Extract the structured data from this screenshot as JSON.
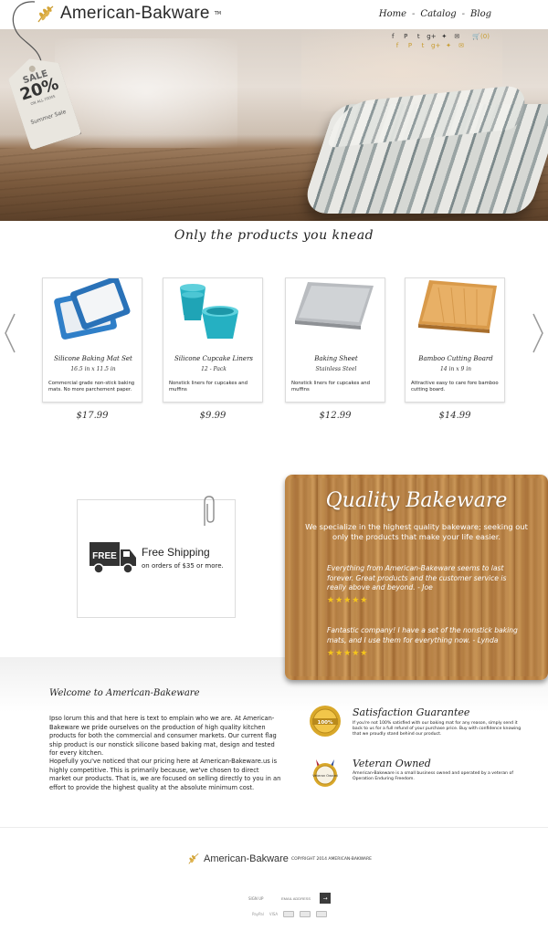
{
  "header": {
    "logo_text": "American-Bakware",
    "logo_tm": "TM",
    "nav": [
      {
        "label": "Home"
      },
      {
        "label": "Catalog"
      },
      {
        "label": "Blog"
      }
    ],
    "nav_sep": "-",
    "social_icons": [
      "facebook-icon",
      "pinterest-icon",
      "tumblr-icon",
      "googleplus-icon",
      "twitter-icon",
      "mail-icon"
    ],
    "cart_count": "(0)"
  },
  "hero": {
    "sale_word": "SALE",
    "sale_percent": "20%",
    "sale_items": "ON ALL ITEMS",
    "sale_event": "Summer Sale"
  },
  "tagline": "Only the products you knead",
  "products": [
    {
      "name": "Silicone Baking Mat Set",
      "sub": "16.5 in x 11.5 in",
      "desc": "Commercial grade non-stick baking mats. No more parchement paper.",
      "price": "$17.99"
    },
    {
      "name": "Silicone Cupcake Liners",
      "sub": "12 - Pack",
      "desc": "Nonstick liners for cupcakes and muffins",
      "price": "$9.99"
    },
    {
      "name": "Baking Sheet",
      "sub": "Stainless Steel",
      "desc": "Nonstick liners for cupcakes and muffins",
      "price": "$12.99"
    },
    {
      "name": "Bamboo Cutting Board",
      "sub": "14 in x 9 in",
      "desc": "Attractive easy to care fore bamboo cutting board.",
      "price": "$14.99"
    }
  ],
  "shipping": {
    "badge": "FREE",
    "title": "Free Shipping",
    "subtitle": "on orders of $35 or more."
  },
  "quality": {
    "title": "Quality Bakeware",
    "text": "We specialize in the highest quality bakeware; seeking out only the products that make your life easier.",
    "quotes": [
      {
        "text": "Everything from American-Bakeware seems to last forever. Great products and the customer service is really above and beyond. - Joe",
        "stars": "★★★★★"
      },
      {
        "text": "Fantastic company! I have a set of the nonstick baking mats, and I use them for everything now. - Lynda",
        "stars": "★★★★★"
      }
    ]
  },
  "welcome": {
    "title": "Welcome to American-Bakeware",
    "p1": "Ipso lorum this and that here is text to emplain who we are. At American-Bakeware we pride ourselves on the production of high quality kitchen products for both the commercial and consumer markets. Our current flag ship product is our nonstick silicone based baking mat, design and tested for every kitchen.",
    "p2": "Hopefully you've noticed that our pricing here at American-Bakeware.us is highly competitive. This is primarily because, we've chosen to direct market our products. That is, we are focused on selling directly to you in an effort to provide the highest quality at the absolute minimum cost."
  },
  "guarantee": {
    "title": "Satisfaction Guarantee",
    "badge_text": "100%",
    "text": "If you're not 100% satisfied with our baking mat for any reason, simply send it back to us for a full refund of your purchase price. Buy with confidence knowing that we proudly stand behind our product."
  },
  "veteran": {
    "title": "Veteran Owned",
    "badge_text": "Veteran Owned",
    "text": "American-Bakeware is a small business owned and operated by a veteran of Operation Enduring Freedom."
  },
  "footer": {
    "logo_text": "American-Bakware",
    "copyright": "COPYRIGHT 2014 AMERICAN-BAKWARE",
    "signup_label": "SIGN UP",
    "email_placeholder": "EMAIL ADDRESS",
    "go": "→",
    "payments": [
      "PayPal",
      "VISA"
    ]
  }
}
